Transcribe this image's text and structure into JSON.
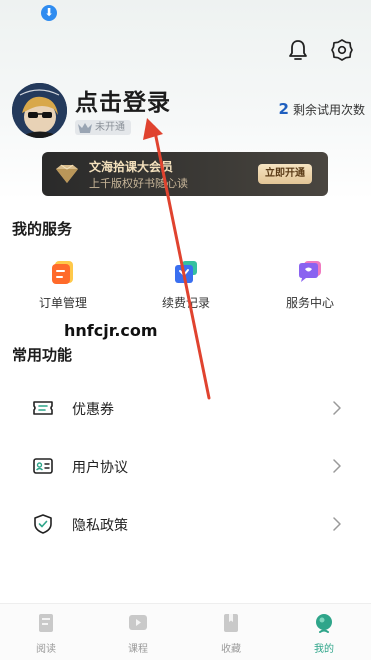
{
  "header": {
    "login_text": "点击登录",
    "vip_status": "未开通",
    "trial_count": "2",
    "trial_label": "剩余试用次数"
  },
  "vip_banner": {
    "title": "文海拾课大会员",
    "subtitle": "上千版权好书随心读",
    "button": "立即开通"
  },
  "services": {
    "title": "我的服务",
    "items": [
      {
        "label": "订单管理",
        "icon": "order-icon"
      },
      {
        "label": "续费记录",
        "icon": "renewal-icon"
      },
      {
        "label": "服务中心",
        "icon": "service-center-icon"
      }
    ]
  },
  "watermark": "hnfcjr.com",
  "functions": {
    "title": "常用功能",
    "items": [
      {
        "label": "优惠券",
        "icon": "coupon-icon"
      },
      {
        "label": "用户协议",
        "icon": "user-agreement-icon"
      },
      {
        "label": "隐私政策",
        "icon": "privacy-shield-icon"
      }
    ]
  },
  "tabs": [
    {
      "label": "阅读",
      "active": false
    },
    {
      "label": "课程",
      "active": false
    },
    {
      "label": "收藏",
      "active": false
    },
    {
      "label": "我的",
      "active": true
    }
  ],
  "colors": {
    "accent": "#2fa58a",
    "annotation_arrow": "#e0432f",
    "trial_number": "#1f5fbf"
  }
}
